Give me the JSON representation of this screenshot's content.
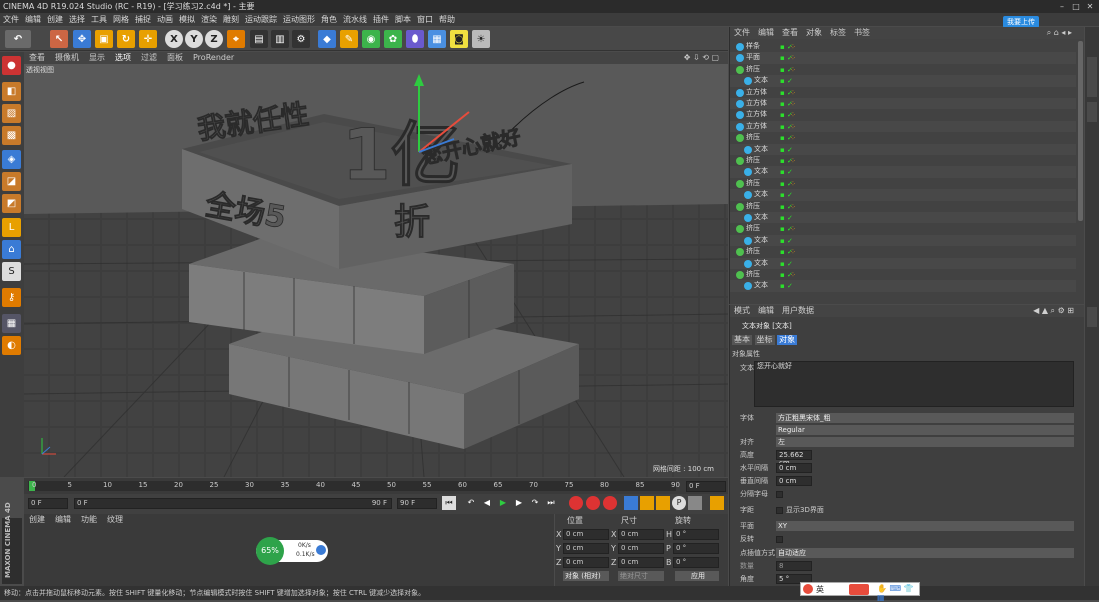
{
  "window": {
    "title": "CINEMA 4D R19.024 Studio (RC - R19) - [学习练习2.c4d *] - 主要",
    "upload_button": "我要上传"
  },
  "menubar": [
    "文件",
    "编辑",
    "创建",
    "选择",
    "工具",
    "网格",
    "捕捉",
    "动画",
    "模拟",
    "渲染",
    "雕刻",
    "运动跟踪",
    "运动图形",
    "角色",
    "流水线",
    "插件",
    "脚本",
    "窗口",
    "帮助"
  ],
  "viewport": {
    "menu": [
      "查看",
      "摄像机",
      "显示",
      "选项",
      "过滤",
      "面板",
      "ProRender"
    ],
    "label": "透视视图",
    "grid_info": "网格间距 : 100 cm"
  },
  "timeline": {
    "ticks": [
      "0",
      "5",
      "10",
      "15",
      "20",
      "25",
      "30",
      "35",
      "40",
      "45",
      "50",
      "55",
      "60",
      "65",
      "70",
      "75",
      "80",
      "85",
      "90"
    ],
    "end_field": "0 F"
  },
  "playback": {
    "start": "0 F",
    "current": "0 F",
    "end": "90 F",
    "max": "90 F",
    "slider_value": "90 F"
  },
  "material_panel": {
    "menu": [
      "创建",
      "编辑",
      "功能",
      "纹理"
    ],
    "logo_text": "MAXON CINEMA 4D",
    "widget": {
      "percent": "65%",
      "up": "0K/s",
      "down": "0.1K/s"
    }
  },
  "coord_panel": {
    "headers": [
      "位置",
      "尺寸",
      "旋转"
    ],
    "rows": [
      {
        "axis": "X",
        "pos": "0 cm",
        "size": "0 cm",
        "rot_label": "H",
        "rot": "0 °"
      },
      {
        "axis": "Y",
        "pos": "0 cm",
        "size": "0 cm",
        "rot_label": "P",
        "rot": "0 °"
      },
      {
        "axis": "Z",
        "pos": "0 cm",
        "size": "0 cm",
        "rot_label": "B",
        "rot": "0 °"
      }
    ],
    "mode": "对象 (相对)",
    "size_mode": "绝对尺寸",
    "apply": "应用"
  },
  "statusbar": "移动：点击并拖动鼠标移动元素。按住 SHIFT 键量化移动；节点编辑模式时按住 SHIFT 键增加选择对象；按住 CTRL 键减少选择对象。",
  "object_manager": {
    "menu": [
      "文件",
      "编辑",
      "查看",
      "对象",
      "标签",
      "书签"
    ],
    "objects": [
      {
        "name": "样条",
        "icon": "spline",
        "level": 0
      },
      {
        "name": "平面",
        "icon": "plane",
        "level": 0
      },
      {
        "name": "挤压",
        "icon": "extrude",
        "level": 0
      },
      {
        "name": "文本",
        "icon": "text",
        "level": 1
      },
      {
        "name": "立方体",
        "icon": "cube",
        "level": 0
      },
      {
        "name": "立方体",
        "icon": "cube",
        "level": 0
      },
      {
        "name": "立方体",
        "icon": "cube",
        "level": 0
      },
      {
        "name": "立方体",
        "icon": "cube",
        "level": 0
      },
      {
        "name": "挤压",
        "icon": "extrude",
        "level": 0
      },
      {
        "name": "文本",
        "icon": "text",
        "level": 1
      },
      {
        "name": "挤压",
        "icon": "extrude",
        "level": 0
      },
      {
        "name": "文本",
        "icon": "text",
        "level": 1
      },
      {
        "name": "挤压",
        "icon": "extrude",
        "level": 0
      },
      {
        "name": "文本",
        "icon": "text",
        "level": 1
      },
      {
        "name": "挤压",
        "icon": "extrude",
        "level": 0
      },
      {
        "name": "文本",
        "icon": "text",
        "level": 1
      },
      {
        "name": "挤压",
        "icon": "extrude",
        "level": 0
      },
      {
        "name": "文本",
        "icon": "text",
        "level": 1
      },
      {
        "name": "挤压",
        "icon": "extrude",
        "level": 0
      },
      {
        "name": "文本",
        "icon": "text",
        "level": 1
      },
      {
        "name": "挤压",
        "icon": "extrude",
        "level": 0
      },
      {
        "name": "文本",
        "icon": "text",
        "level": 1
      }
    ]
  },
  "attribute_manager": {
    "menu": [
      "模式",
      "编辑",
      "用户数据"
    ],
    "object_title": "文本对象 [文本]",
    "tabs": [
      "基本",
      "坐标",
      "对象"
    ],
    "section": "对象属性",
    "text_label": "文本",
    "text_value": "您开心就好",
    "font_label": "字体",
    "font_value": "方正粗黑宋体_粗",
    "style_value": "Regular",
    "align_label": "对齐",
    "align_value": "左",
    "height_label": "高度",
    "height_value": "25.662 cm",
    "hspace_label": "水平间隔",
    "hspace_value": "0 cm",
    "vspace_label": "垂直间隔",
    "vspace_value": "0 cm",
    "separate_label": "分隔字母",
    "kerning_label": "字距",
    "show3d_label": "显示3D界面",
    "plane_label": "平面",
    "plane_value": "XY",
    "reverse_label": "反转",
    "interp_label": "点插值方式",
    "interp_value": "自动适应",
    "count_label": "数量",
    "count_value": "8",
    "angle_label": "角度",
    "angle_value": "5 °"
  },
  "ime": {
    "label": "英"
  },
  "scene_text": {
    "top": "我就任性",
    "big": "1亿",
    "slogan": "您开心就好",
    "front1": "全场5",
    "front2": "折"
  }
}
